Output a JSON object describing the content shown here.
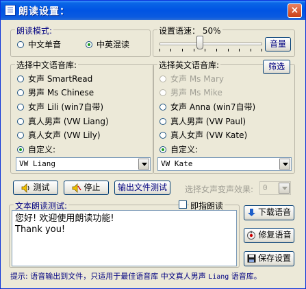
{
  "window": {
    "title": "朗读设置：",
    "close_label": "×"
  },
  "mode": {
    "label": "朗读模式:",
    "options": [
      {
        "label": "中文单音",
        "selected": false
      },
      {
        "label": "中英混读",
        "selected": true
      }
    ]
  },
  "speed": {
    "label": "设置语速： 50%",
    "value_percent": 50,
    "button": "音量"
  },
  "cn_voice": {
    "label": "选择中文语音库:",
    "options": [
      {
        "label": "女声 SmartRead",
        "selected": false
      },
      {
        "label": "男声 Ms Chinese",
        "selected": false
      },
      {
        "label": "女声 Lili (win7自带)",
        "selected": false
      },
      {
        "label": "真人男声 (VW Liang)",
        "selected": false
      },
      {
        "label": "真人女声 (VW Lily)",
        "selected": false
      },
      {
        "label": "自定义:",
        "selected": true
      }
    ],
    "custom_value": "VW Liang"
  },
  "en_voice": {
    "label": "选择英文语音库:",
    "filter_button": "筛选",
    "options": [
      {
        "label": "女声 Ms Mary",
        "selected": false,
        "disabled": true
      },
      {
        "label": "男声 Ms Mike",
        "selected": false,
        "disabled": true
      },
      {
        "label": "女声 Anna (win7自带)",
        "selected": false,
        "disabled": false
      },
      {
        "label": "真人男声 (VW Paul)",
        "selected": false,
        "disabled": false
      },
      {
        "label": "真人女声 (VW Kate)",
        "selected": false,
        "disabled": false
      },
      {
        "label": "自定义:",
        "selected": true,
        "disabled": false
      }
    ],
    "custom_value": "VW Kate"
  },
  "actions": {
    "test": "测试",
    "stop": "停止",
    "export_test": "输出文件测试",
    "female_effect_label": "选择女声变声效果:",
    "female_effect_value": "0"
  },
  "text_test": {
    "label": "文本朗读测试:",
    "instant_label": "即指朗读",
    "content": "您好! 欢迎使用朗读功能!\nThank you!"
  },
  "side_buttons": {
    "download": "下载语音",
    "repair": "修复语音",
    "save": "保存设置"
  },
  "hint": {
    "prefix": "提示: 语音输出到文件，只适用于最佳语音库 中文真人男声 ",
    "voice": "Liang",
    "suffix": " 语音库。"
  }
}
